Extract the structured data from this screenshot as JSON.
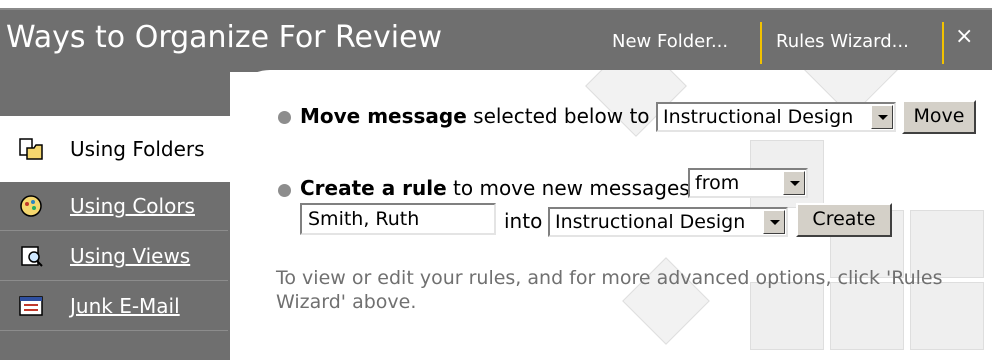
{
  "header": {
    "title": "Ways to Organize For Review",
    "new_folder": "New Folder...",
    "rules_wizard": "Rules Wizard...",
    "close": "×"
  },
  "nav": {
    "items": [
      {
        "label": "Using Folders",
        "icon": "folder-icon",
        "active": true
      },
      {
        "label": "Using Colors",
        "icon": "colors-icon",
        "active": false
      },
      {
        "label": "Using Views",
        "icon": "views-icon",
        "active": false
      },
      {
        "label": "Junk E-Mail",
        "icon": "junk-mail-icon",
        "active": false
      }
    ]
  },
  "move": {
    "bold": "Move message",
    "rest": " selected below to",
    "folder": "Instructional Design",
    "button": "Move"
  },
  "rule": {
    "bold": "Create a rule",
    "rest": " to move new messages",
    "condition": "from",
    "sender": "Smith, Ruth",
    "into": "into",
    "folder": "Instructional Design",
    "button": "Create"
  },
  "hint": "To view or edit your rules, and for more advanced options, click 'Rules Wizard' above."
}
